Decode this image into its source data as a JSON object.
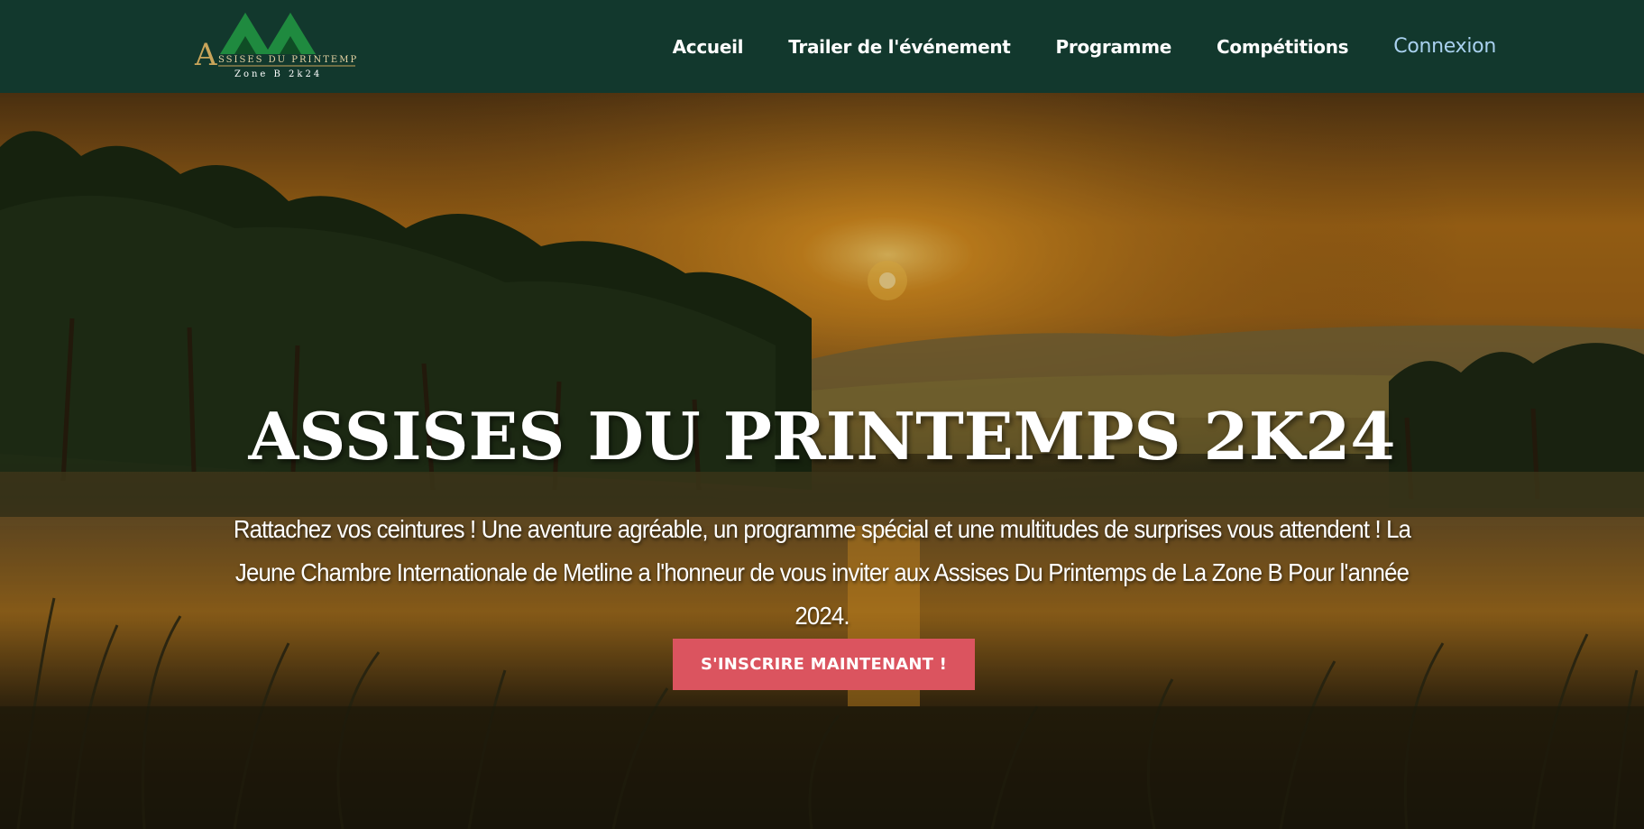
{
  "logo": {
    "title": "ASSISES DU PRINTEMPS",
    "subtitle": "Zone B 2K24",
    "colors": {
      "mountains": "#1f8a3f",
      "gold": "#c9a55a"
    }
  },
  "nav": {
    "items": [
      {
        "label": "Accueil"
      },
      {
        "label": "Trailer de l'événement"
      },
      {
        "label": "Programme"
      },
      {
        "label": "Compétitions"
      }
    ],
    "login_label": "Connexion"
  },
  "hero": {
    "title": "ASSISES DU PRINTEMPS 2K24",
    "description": "Rattachez vos ceintures ! Une aventure agréable, un programme spécial et une multitudes de surprises vous attendent ! La Jeune Chambre Internationale de Metline a l'honneur de vous inviter aux Assises Du Printemps de La Zone B Pour l'année 2024.",
    "cta_label": "S'INSCRIRE MAINTENANT !"
  },
  "colors": {
    "navbar": "#12382d",
    "cta": "#db545f",
    "login_link": "#a9d1ef"
  }
}
